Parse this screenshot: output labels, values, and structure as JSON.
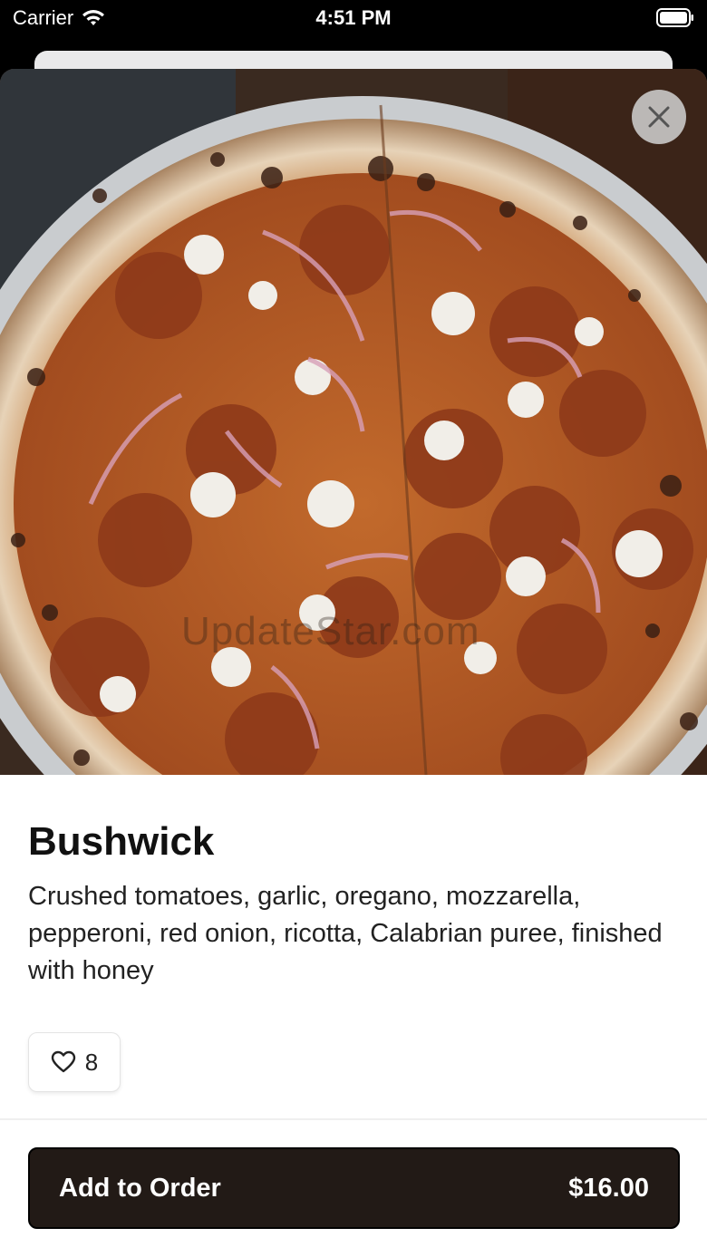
{
  "status_bar": {
    "carrier": "Carrier",
    "time": "4:51 PM",
    "icons": [
      "wifi-icon",
      "battery-icon"
    ]
  },
  "item": {
    "name": "Bushwick",
    "description": "Crushed tomatoes, garlic, oregano, mozzarella, pepperoni, red onion, ricotta, Calabrian puree, finished with honey",
    "image_label": "pizza-photo",
    "watermark": "UpdateStar.com",
    "likes": "8"
  },
  "actions": {
    "close_icon": "close-icon",
    "like_icon": "heart-icon",
    "add_label": "Add to Order",
    "price": "$16.00"
  },
  "colors": {
    "button_bg": "#221a16",
    "close_bg": "#d2d2d2"
  }
}
